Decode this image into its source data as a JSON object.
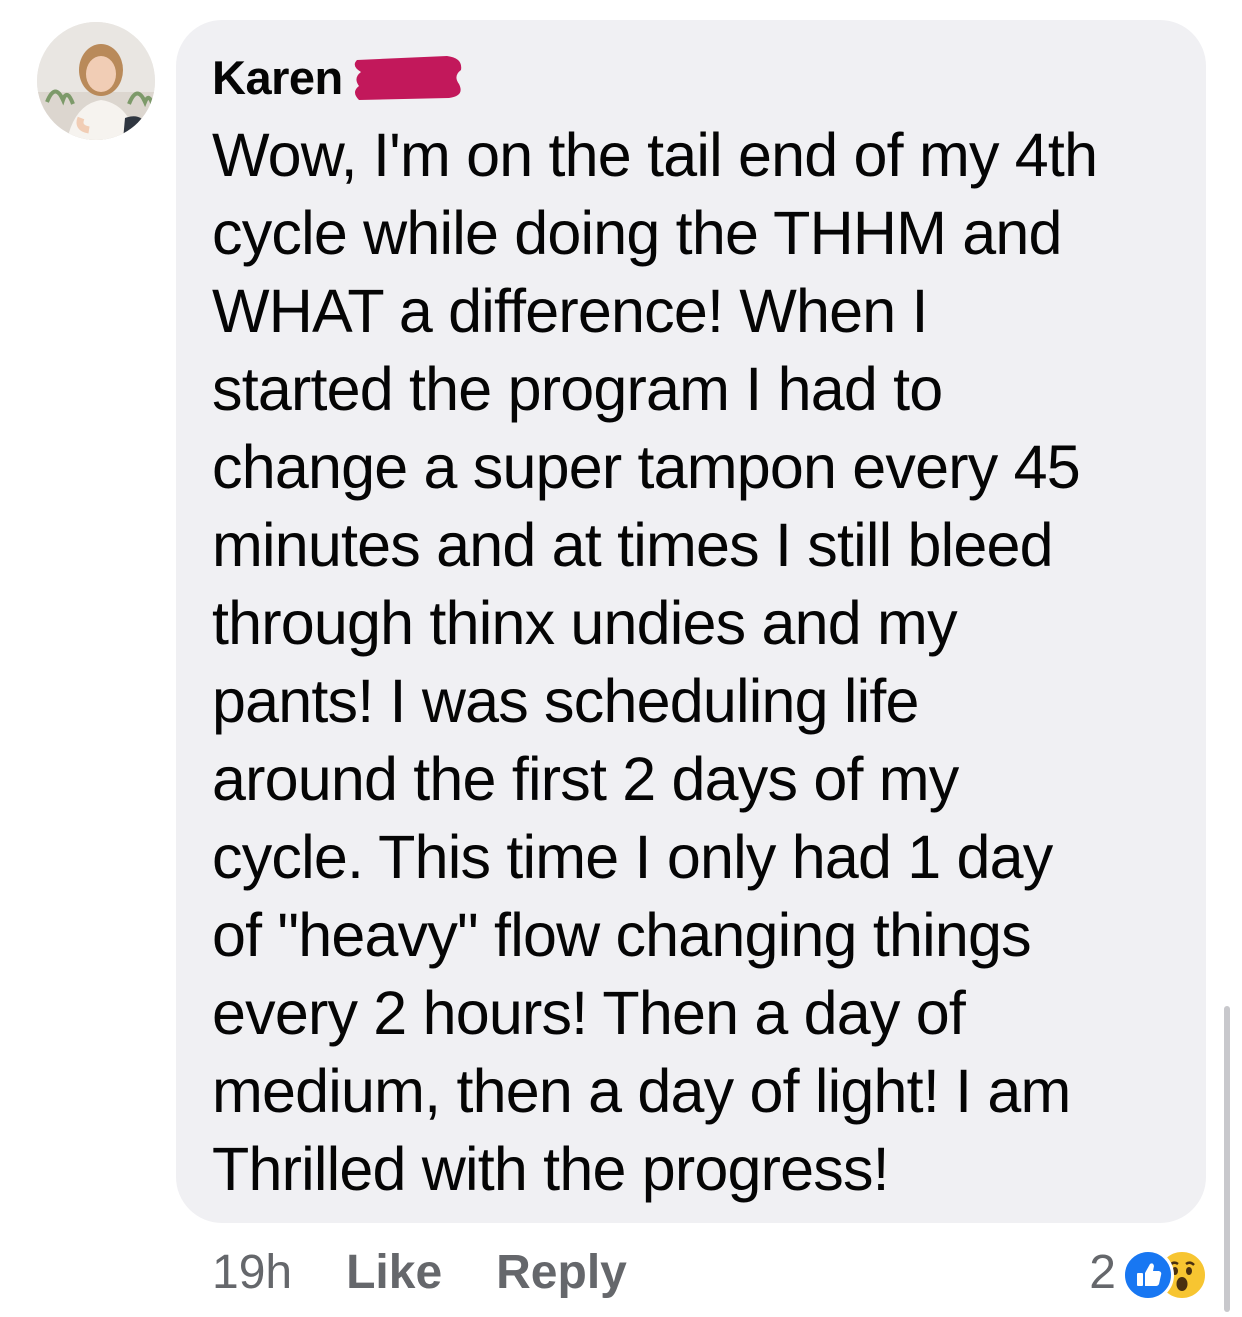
{
  "comment": {
    "author": "Karen",
    "text": "Wow, I'm on the tail end of my 4th\ncycle while doing the THHM and\nWHAT a difference!  When I\nstarted the program I had to\nchange a super tampon every 45\nminutes and at times I still bleed\nthrough thinx undies and my\npants!  I was scheduling life\naround the first 2 days of my\ncycle.  This time I only had 1 day\nof \"heavy\" flow changing things\nevery 2 hours!  Then a day of\nmedium, then a day of light!  I am\nThrilled with the progress!",
    "timestamp": "19h",
    "like_label": "Like",
    "reply_label": "Reply",
    "reaction_count": "2",
    "reactions": [
      "like-icon",
      "wow-icon"
    ]
  },
  "colors": {
    "bubble": "#f0f0f3",
    "text": "#050505",
    "secondary": "#65676b",
    "redaction": "#c2185b",
    "like_blue": "#1877f2",
    "wow_yellow": "#f7c531"
  }
}
